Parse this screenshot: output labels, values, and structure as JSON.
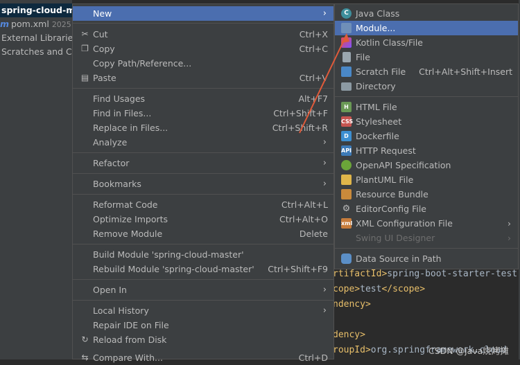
{
  "project_tree": {
    "selected": "spring-cloud-ma",
    "pom": "pom.xml",
    "pom_date": "2025",
    "external_libraries": "External Libraries",
    "scratches": "Scratches and Co"
  },
  "editor": {
    "lines": [
      {
        "tag": "rtifactId>",
        "text": "spring-boot-starter-test"
      },
      {
        "tag": "cope>",
        "text": "test",
        "close": "</scope>"
      },
      {
        "tag": "ndency>",
        "text": ""
      },
      {
        "tag": "",
        "text": ""
      },
      {
        "tag": "dency>",
        "text": ""
      },
      {
        "tag": "roupId>",
        "text": "org.springframework.cloud"
      }
    ]
  },
  "watermark": "CSDN @java烧烤摊",
  "context_menu": {
    "new": "New",
    "cut": "Cut",
    "cut_sc": "Ctrl+X",
    "copy": "Copy",
    "copy_sc": "Ctrl+C",
    "copy_path": "Copy Path/Reference...",
    "paste": "Paste",
    "paste_sc": "Ctrl+V",
    "find_usages": "Find Usages",
    "find_usages_sc": "Alt+F7",
    "find_in_files": "Find in Files...",
    "find_in_files_sc": "Ctrl+Shift+F",
    "replace_in_files": "Replace in Files...",
    "replace_in_files_sc": "Ctrl+Shift+R",
    "analyze": "Analyze",
    "refactor": "Refactor",
    "bookmarks": "Bookmarks",
    "reformat_code": "Reformat Code",
    "reformat_code_sc": "Ctrl+Alt+L",
    "optimize_imports": "Optimize Imports",
    "optimize_imports_sc": "Ctrl+Alt+O",
    "remove_module": "Remove Module",
    "remove_module_sc": "Delete",
    "build_module": "Build Module 'spring-cloud-master'",
    "rebuild_module": "Rebuild Module 'spring-cloud-master'",
    "rebuild_module_sc": "Ctrl+Shift+F9",
    "open_in": "Open In",
    "local_history": "Local History",
    "repair_ide": "Repair IDE on File",
    "reload_from_disk": "Reload from Disk",
    "compare_with": "Compare With...",
    "compare_with_sc": "Ctrl+D"
  },
  "new_submenu": {
    "java_class": "Java Class",
    "module": "Module...",
    "kotlin": "Kotlin Class/File",
    "file": "File",
    "scratch_file": "Scratch File",
    "scratch_file_sc": "Ctrl+Alt+Shift+Insert",
    "directory": "Directory",
    "html_file": "HTML File",
    "stylesheet": "Stylesheet",
    "dockerfile": "Dockerfile",
    "http_request": "HTTP Request",
    "openapi": "OpenAPI Specification",
    "plantuml": "PlantUML File",
    "resource_bundle": "Resource Bundle",
    "editorconfig": "EditorConfig File",
    "xml_config": "XML Configuration File",
    "swing_ui": "Swing UI Designer",
    "data_source": "Data Source in Path"
  },
  "colors": {
    "highlight": "#4b6eaf",
    "menu_bg": "#3c3f41",
    "arrow": "#e05a3a"
  }
}
